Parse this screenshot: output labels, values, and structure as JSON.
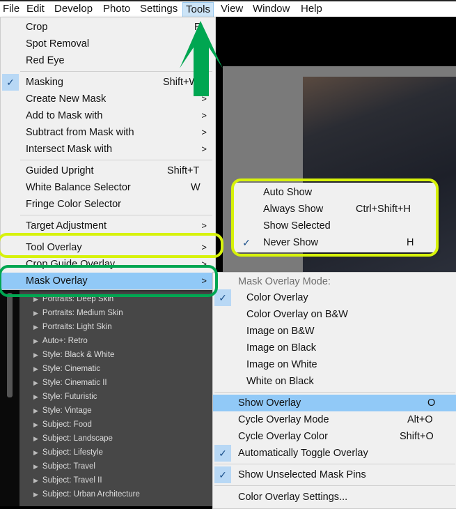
{
  "menubar": [
    "File",
    "Edit",
    "Develop",
    "Photo",
    "Settings",
    "Tools",
    "View",
    "Window",
    "Help"
  ],
  "tools_menu": {
    "crop": "Crop",
    "crop_sc": "R",
    "spot": "Spot Removal",
    "red_eye": "Red Eye",
    "masking": "Masking",
    "masking_sc": "Shift+W",
    "create_mask": "Create New Mask",
    "add_mask": "Add to Mask with",
    "subtract_mask": "Subtract from Mask with",
    "intersect_mask": "Intersect Mask with",
    "guided": "Guided Upright",
    "guided_sc": "Shift+T",
    "wb": "White Balance Selector",
    "wb_sc": "W",
    "fringe": "Fringe Color Selector",
    "target": "Target Adjustment",
    "tool_overlay": "Tool Overlay",
    "crop_guide": "Crop Guide Overlay",
    "mask_overlay": "Mask Overlay"
  },
  "tool_overlay_menu": {
    "auto": "Auto Show",
    "always": "Always Show",
    "always_sc": "Ctrl+Shift+H",
    "selected": "Show Selected",
    "never": "Never Show",
    "never_sc": "H"
  },
  "mask_overlay_menu": {
    "header": "Mask Overlay Mode:",
    "modes": [
      "Color Overlay",
      "Color Overlay on B&W",
      "Image on B&W",
      "Image on Black",
      "Image on White",
      "White on Black"
    ],
    "show": "Show Overlay",
    "show_sc": "O",
    "cycle_mode": "Cycle Overlay Mode",
    "cycle_mode_sc": "Alt+O",
    "cycle_color": "Cycle Overlay Color",
    "cycle_color_sc": "Shift+O",
    "auto_toggle": "Automatically Toggle Overlay",
    "pins": "Show Unselected Mask Pins",
    "settings": "Color Overlay Settings..."
  },
  "presets": [
    "Portraits: Deep Skin",
    "Portraits: Medium Skin",
    "Portraits: Light Skin",
    "Auto+: Retro",
    "Style: Black & White",
    "Style: Cinematic",
    "Style: Cinematic II",
    "Style: Futuristic",
    "Style: Vintage",
    "Subject: Food",
    "Subject: Landscape",
    "Subject: Lifestyle",
    "Subject: Travel",
    "Subject: Travel II",
    "Subject: Urban Architecture"
  ],
  "colors": {
    "highlight": "#91c9f7",
    "yellow_ring": "#d7f20a",
    "green_ring": "#00a651"
  }
}
